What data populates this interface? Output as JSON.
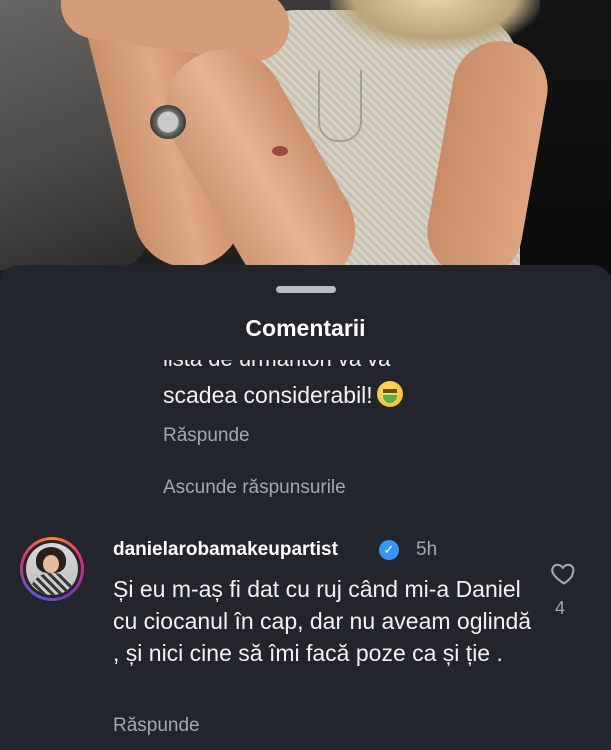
{
  "sheet": {
    "title": "Comentarii"
  },
  "previous_reply": {
    "text_cut": "lista de urmăritori va va",
    "text": "scadea considerabil!",
    "emoji": "nauseated-face-icon",
    "reply_label": "Răspunde"
  },
  "hide_replies_label": "Ascunde răspunsurile",
  "comment": {
    "username": "danielarobamakeupartist",
    "time": "5h",
    "text": "Și eu m-aș fi dat cu ruj când mi-a Daniel cu ciocanul în cap, dar nu aveam oglindă , și nici cine să îmi facă poze ca și ție .",
    "likes": "4",
    "reply_label": "Răspunde"
  },
  "colors": {
    "sheet_bg": "#22262c",
    "secondary_text": "#a2a8b0",
    "verified_badge": "#3797f0"
  }
}
